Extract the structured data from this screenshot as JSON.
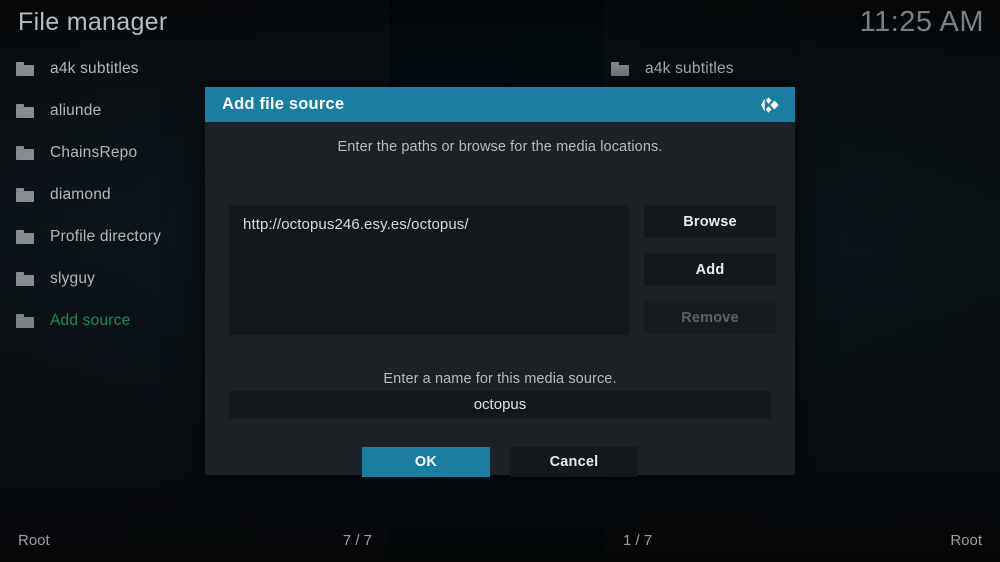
{
  "colors": {
    "accent_blue": "#1a7ea3",
    "accent_green": "#1f8a52",
    "dialog_bg": "#1b2125",
    "field_bg": "#14181b",
    "text_primary": "#b3b7b9",
    "text_disabled": "#5d6265"
  },
  "header": {
    "title": "File manager",
    "clock": "11:25 AM"
  },
  "left_panel": {
    "items": [
      {
        "label": "a4k subtitles",
        "icon": "folder-icon",
        "accent": false
      },
      {
        "label": "aliunde",
        "icon": "folder-icon",
        "accent": false
      },
      {
        "label": "ChainsRepo",
        "icon": "folder-icon",
        "accent": false
      },
      {
        "label": "diamond",
        "icon": "folder-icon",
        "accent": false
      },
      {
        "label": "Profile directory",
        "icon": "folder-icon",
        "accent": false
      },
      {
        "label": "slyguy",
        "icon": "folder-icon",
        "accent": false
      },
      {
        "label": "Add source",
        "icon": "folder-icon",
        "accent": true
      }
    ],
    "status": {
      "path": "Root",
      "count": "7 / 7"
    }
  },
  "right_panel": {
    "items": [
      {
        "label": "a4k subtitles",
        "icon": "folder-icon",
        "accent": false
      }
    ],
    "status": {
      "count": "1 / 7",
      "path": "Root"
    }
  },
  "dialog": {
    "title": "Add file source",
    "logo_icon": "kodi-logo-icon",
    "paths_hint": "Enter the paths or browse for the media locations.",
    "path_value": "http://octopus246.esy.es/octopus/",
    "side_buttons": [
      {
        "label": "Browse",
        "disabled": false
      },
      {
        "label": "Add",
        "disabled": false
      },
      {
        "label": "Remove",
        "disabled": true
      }
    ],
    "name_hint": "Enter a name for this media source.",
    "name_value": "octopus",
    "footer_buttons": [
      {
        "label": "OK",
        "style": "primary"
      },
      {
        "label": "Cancel",
        "style": "normal"
      }
    ]
  }
}
